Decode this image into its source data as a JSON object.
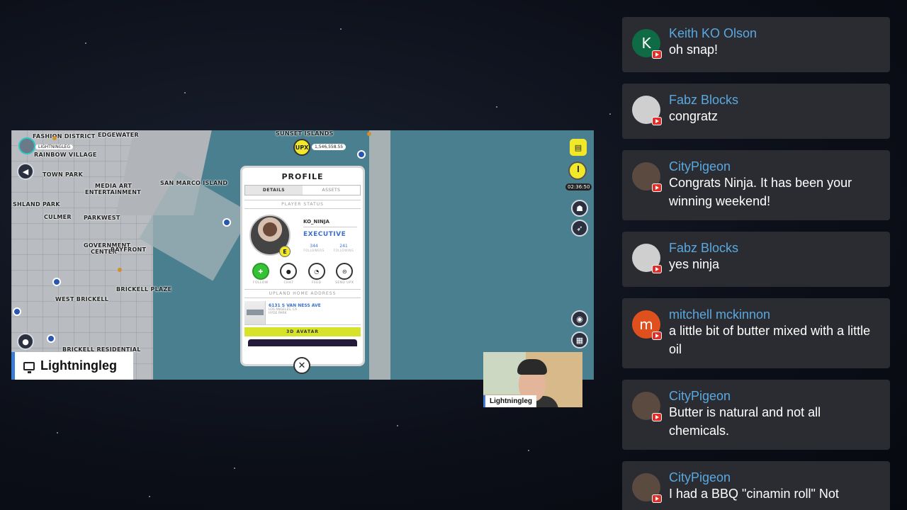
{
  "game": {
    "map_labels": [
      "FASHION DISTRICT",
      "EDGEWATER",
      "RAINBOW VILLAGE",
      "TOWN PARK",
      "MEDIA ART",
      "ENTERTAINMENT",
      "SHLAND PARK",
      "CULMER",
      "PARKWEST",
      "GOVERNMENT",
      "CENTER",
      "BAYFRONT",
      "WEST BRICKELL",
      "BRICKELL PLAZE",
      "BRICKELL RESIDENTIAL",
      "SUNSET ISLANDS",
      "SAN MARCO ISLAND"
    ],
    "player_mini_name": "LIGHTNINGLEG",
    "upx_label": "UPX",
    "upx_balance": "1,546,558.55",
    "timer": "02:36:50",
    "profile": {
      "title": "PROFILE",
      "tabs": [
        "DETAILS",
        "ASSETS"
      ],
      "section_status": "PLAYER STATUS",
      "username": "KO_NINJA",
      "rank": "EXECUTIVE",
      "badge": "E",
      "followers_value": "344",
      "followers_label": "FOLLOWERS",
      "following_value": "241",
      "following_label": "FOLLOWING",
      "actions": [
        "FOLLOW",
        "CHAT",
        "FEED",
        "SEND UPX"
      ],
      "section_home": "UPLAND HOME ADDRESS",
      "address_street": "6131 S VAN NESS AVE",
      "address_city": "LOS ANGELES, CA",
      "address_hood": "HYDE PARK",
      "avatar_button": "3D AVATAR"
    },
    "close_glyph": "✕"
  },
  "streamer": {
    "name": "Lightningleg",
    "webcam_label": "Lightningleg"
  },
  "chat": {
    "messages": [
      {
        "author": "Keith KO Olson",
        "text": "oh snap!",
        "avatar_letter": "K",
        "avatar_color": "#0f6b45"
      },
      {
        "author": "Fabz Blocks",
        "text": "congratz",
        "avatar_letter": "",
        "avatar_color": "#cfcfcf"
      },
      {
        "author": "CityPigeon",
        "text": "Congrats Ninja. It has been your winning weekend!",
        "avatar_letter": "",
        "avatar_color": "#5a4a40"
      },
      {
        "author": "Fabz Blocks",
        "text": "yes ninja",
        "avatar_letter": "",
        "avatar_color": "#cfcfcf"
      },
      {
        "author": "mitchell mckinnon",
        "text": "a little bit of butter mixed with a little oil",
        "avatar_letter": "m",
        "avatar_color": "#e0501e"
      },
      {
        "author": "CityPigeon",
        "text": "Butter is natural and not all chemicals.",
        "avatar_letter": "",
        "avatar_color": "#5a4a40"
      },
      {
        "author": "CityPigeon",
        "text": "I had a BBQ \"cinamin roll\" Not",
        "avatar_letter": "",
        "avatar_color": "#5a4a40"
      }
    ]
  }
}
